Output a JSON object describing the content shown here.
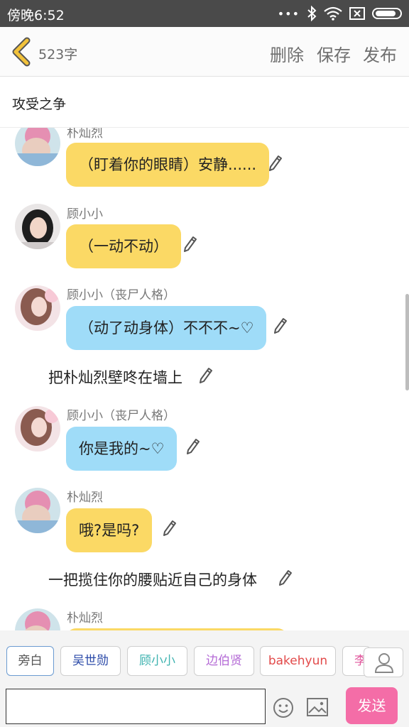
{
  "status_bar": {
    "time": "傍晚6:52",
    "icons": [
      "signal-dots-icon",
      "bluetooth-icon",
      "wifi-icon",
      "sim-x-icon",
      "battery-icon"
    ]
  },
  "header": {
    "char_count": "523字",
    "delete_label": "删除",
    "save_label": "保存",
    "publish_label": "发布"
  },
  "story_title": "攻受之争",
  "messages": [
    {
      "type": "role",
      "name": "朴灿烈",
      "text": "（盯着你的眼睛）安静......",
      "bubble": "yellow"
    },
    {
      "type": "role",
      "name": "顾小小",
      "text": "（一动不动）",
      "bubble": "yellow"
    },
    {
      "type": "role",
      "name": "顾小小（丧尸人格）",
      "text": "（动了动身体）不不不~♡",
      "bubble": "blue"
    },
    {
      "type": "narration",
      "text": "把朴灿烈壁咚在墙上"
    },
    {
      "type": "role",
      "name": "顾小小（丧尸人格）",
      "text": "你是我的~♡",
      "bubble": "blue"
    },
    {
      "type": "role",
      "name": "朴灿烈",
      "text": "哦?是吗?",
      "bubble": "yellow"
    },
    {
      "type": "narration",
      "text": "一把揽住你的腰贴近自己的身体"
    },
    {
      "type": "role",
      "name": "朴灿烈",
      "text": "",
      "bubble": "yellow"
    }
  ],
  "roles": [
    {
      "label": "旁白",
      "color": "#555555"
    },
    {
      "label": "吴世勋",
      "color": "#2b4aa8"
    },
    {
      "label": "顾小小",
      "color": "#3fb3b0"
    },
    {
      "label": "边伯贤",
      "color": "#b46ad6"
    },
    {
      "label": "bakehyun",
      "color": "#e24a4a"
    },
    {
      "label": "李",
      "color": "#e0559b"
    }
  ],
  "composer": {
    "input_value": "",
    "send_label": "发送"
  },
  "colors": {
    "bubble_yellow": "#fbd965",
    "bubble_blue": "#9fdcf8",
    "send": "#f46da7",
    "back_arrow": "#f2c23a"
  }
}
